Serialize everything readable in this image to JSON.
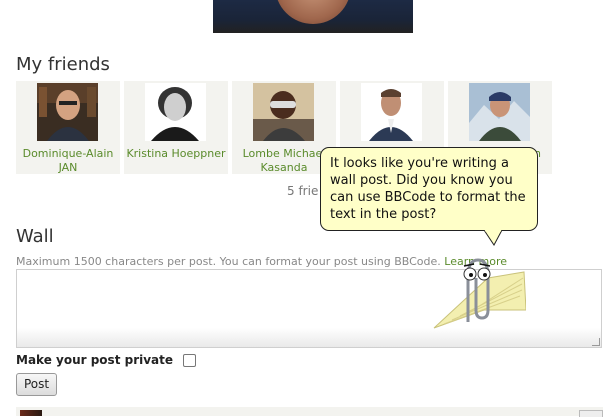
{
  "sections": {
    "friends_title": "My friends",
    "wall_title": "Wall"
  },
  "friends": [
    {
      "name": "Dominique-Alain JAN"
    },
    {
      "name": "Kristina Hoeppner"
    },
    {
      "name": "Lombe Michael Kasanda"
    },
    {
      "name": ""
    },
    {
      "name": "n"
    }
  ],
  "friends_count_text": "5 frie",
  "wall": {
    "hint": "Maximum 1500 characters per post. You can format your post using BBCode.",
    "learn_more": "Learn more",
    "textarea_value": "",
    "private_label": "Make your post private",
    "post_button": "Post"
  },
  "tooltip": {
    "text": "It looks like you're writing a wall post. Did you know you can use BBCode to format the text in the post?"
  },
  "colors": {
    "link_green": "#5a8b2b",
    "card_bg": "#f3f3ef",
    "tooltip_bg": "#ffffc8"
  }
}
